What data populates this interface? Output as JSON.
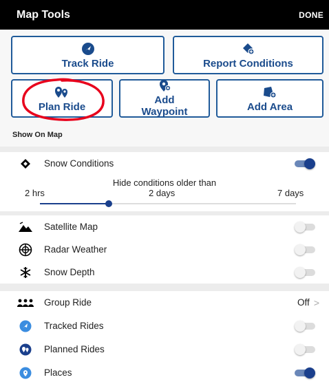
{
  "header": {
    "title": "Map Tools",
    "done_label": "DONE"
  },
  "tools": {
    "track_ride": "Track Ride",
    "report_conditions": "Report Conditions",
    "plan_ride": "Plan Ride",
    "add_waypoint_line1": "Add",
    "add_waypoint_line2": "Waypoint",
    "add_area": "Add Area",
    "annotation_color": "#e8001c"
  },
  "show_on_map": {
    "label": "Show On Map"
  },
  "snow_conditions": {
    "label": "Snow Conditions",
    "on": true
  },
  "conditions_slider": {
    "caption": "Hide conditions older than",
    "ticks": [
      "2 hrs",
      "2 days",
      "7 days"
    ],
    "selected": "2 days",
    "fraction": 0.27
  },
  "layers": [
    {
      "label": "Satellite Map",
      "icon": "mountain-icon",
      "on": false
    },
    {
      "label": "Radar Weather",
      "icon": "radar-icon",
      "on": false
    },
    {
      "label": "Snow Depth",
      "icon": "snowflake-icon",
      "on": false
    }
  ],
  "group_ride": {
    "label": "Group Ride",
    "value": "Off"
  },
  "rides": [
    {
      "label": "Tracked Rides",
      "icon": "tracked-rides-icon",
      "on": false
    },
    {
      "label": "Planned Rides",
      "icon": "planned-rides-icon",
      "on": false
    },
    {
      "label": "Places",
      "icon": "places-icon",
      "on": true
    }
  ],
  "colors": {
    "accent": "#1a3f8c",
    "button_border": "#1f5a99",
    "header_bg": "#000000"
  }
}
